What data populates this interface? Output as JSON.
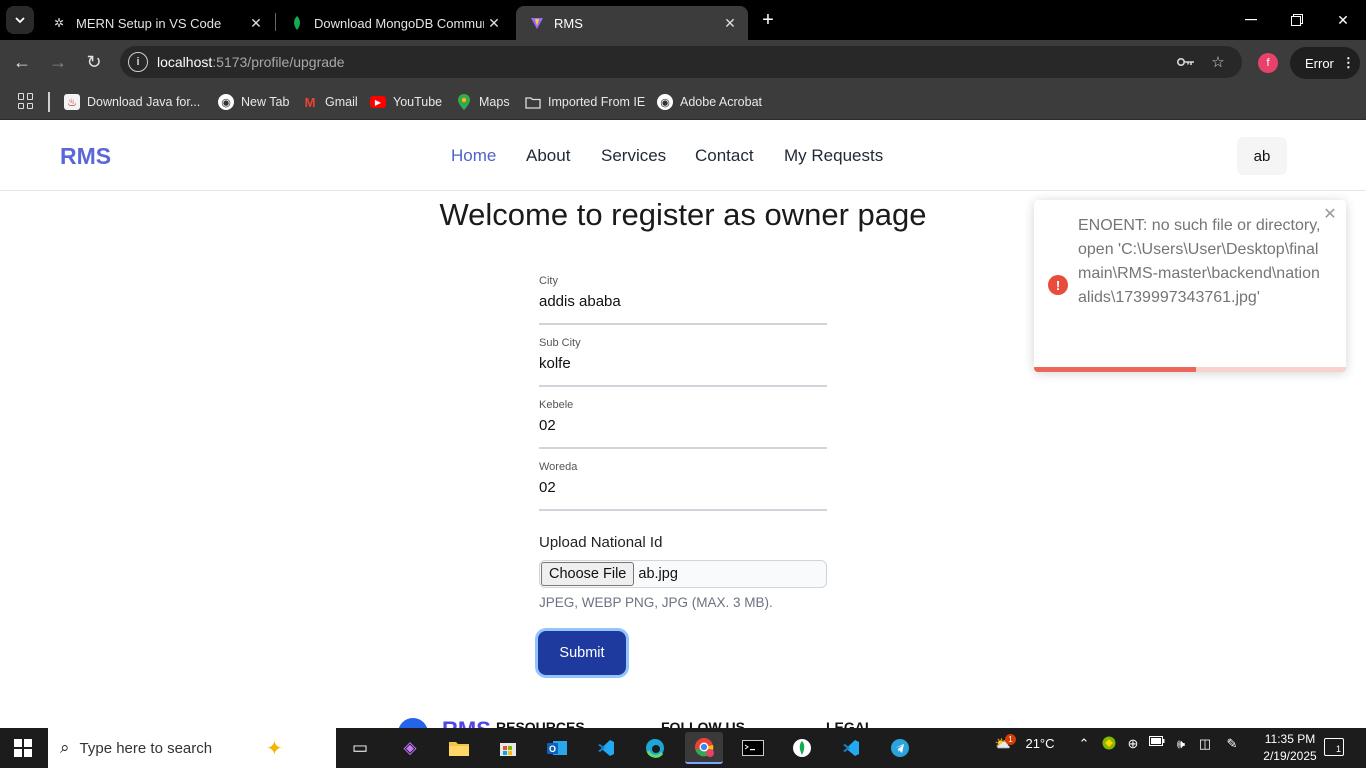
{
  "browser": {
    "tabs": [
      {
        "title": "MERN Setup in VS Code",
        "favicon": "chatgpt-icon",
        "active": false
      },
      {
        "title": "Download MongoDB Communi",
        "favicon": "mongodb-leaf-icon",
        "active": false
      },
      {
        "title": "RMS",
        "favicon": "vite-icon",
        "active": true
      }
    ],
    "url_host": "localhost",
    "url_path": ":5173/profile/upgrade",
    "profile_initial": "f",
    "error_chip": "Error",
    "bookmarks": [
      {
        "label": "Download Java for...",
        "icon": "java-icon"
      },
      {
        "label": "New Tab",
        "icon": "globe-icon"
      },
      {
        "label": "Gmail",
        "icon": "gmail-icon"
      },
      {
        "label": "YouTube",
        "icon": "youtube-icon"
      },
      {
        "label": "Maps",
        "icon": "maps-pin-icon"
      },
      {
        "label": "Imported From IE",
        "icon": "folder-icon"
      },
      {
        "label": "Adobe Acrobat",
        "icon": "globe-icon"
      }
    ]
  },
  "site": {
    "brand": "RMS",
    "nav": [
      "Home",
      "About",
      "Services",
      "Contact",
      "My Requests"
    ],
    "active_nav": "Home",
    "user_label": "ab"
  },
  "form": {
    "title": "Welcome to register as owner page",
    "fields": [
      {
        "label": "City",
        "value": "addis ababa"
      },
      {
        "label": "Sub City",
        "value": "kolfe"
      },
      {
        "label": "Kebele",
        "value": "02"
      },
      {
        "label": "Woreda",
        "value": "02"
      }
    ],
    "upload_label": "Upload National Id",
    "choose_file": "Choose File",
    "file_name": "ab.jpg",
    "upload_hint": "JPEG, WEBP PNG, JPG (MAX. 3 MB).",
    "submit": "Submit"
  },
  "footer": {
    "logo_text": "RMS",
    "headings": [
      "RESOURCES",
      "FOLLOW US",
      "LEGAL"
    ]
  },
  "toast": {
    "message": "ENOENT: no such file or directory, open 'C:\\Users\\User\\Desktop\\final main\\RMS-master\\backend\\nationalids\\1739997343761.jpg'",
    "progress": 0.52,
    "color": "#e74c3c"
  },
  "taskbar": {
    "search_placeholder": "Type here to search",
    "weather": "21°C",
    "time": "11:35 PM",
    "date": "2/19/2025",
    "notification_count": "1",
    "weather_badge": "1"
  }
}
